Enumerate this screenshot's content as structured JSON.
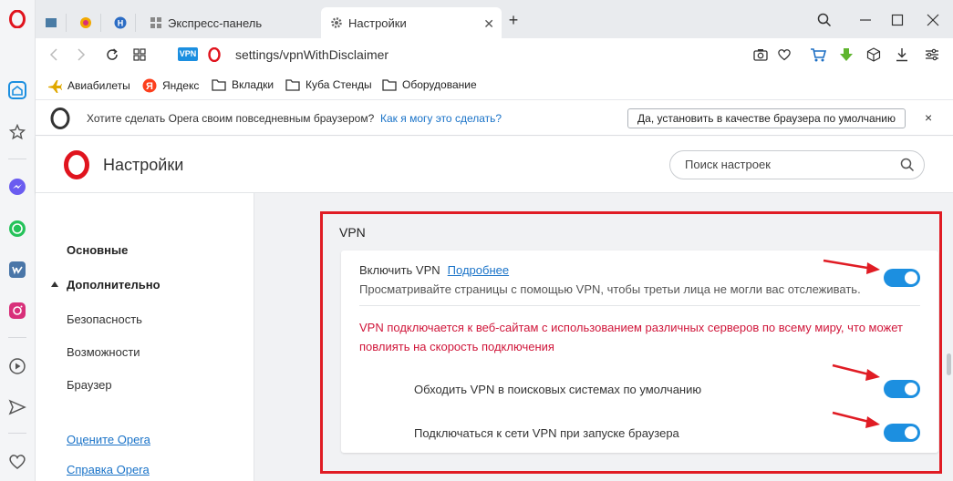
{
  "browser": {
    "tabs": [
      {
        "label": ""
      },
      {
        "label": ""
      },
      {
        "label": ""
      },
      {
        "label": "Экспресс-панель"
      },
      {
        "label": "Настройки"
      }
    ],
    "new_tab": "+",
    "url": "settings/vpnWithDisclaimer",
    "vpn_badge": "VPN"
  },
  "bookmarks": [
    {
      "label": "Авиабилеты",
      "icon": "plane-icon"
    },
    {
      "label": "Яндекс",
      "icon": "yandex-icon"
    },
    {
      "label": "Вкладки",
      "icon": "folder-icon"
    },
    {
      "label": "Куба Стенды",
      "icon": "folder-icon"
    },
    {
      "label": "Оборудование",
      "icon": "folder-icon"
    }
  ],
  "infobar": {
    "message": "Хотите сделать Opera своим повседневным браузером?",
    "link": "Как я могу это сделать?",
    "button": "Да, установить в качестве браузера по умолчанию",
    "close": "×"
  },
  "settings": {
    "title": "Настройки",
    "search_placeholder": "Поиск настроек"
  },
  "menu": {
    "basic": "Основные",
    "advanced": "Дополнительно",
    "items": [
      "Безопасность",
      "Возможности",
      "Браузер"
    ],
    "links": [
      "Оцените Opera",
      "Справка Opera"
    ]
  },
  "vpn": {
    "section_title": "VPN",
    "enable_label": "Включить VPN",
    "more_link": "Подробнее",
    "enable_desc": "Просматривайте страницы с помощью VPN, чтобы третьи лица не могли вас отслеживать.",
    "warning": "VPN подключается к веб-сайтам с использованием различных серверов по всему миру, что может повлиять на скорость подключения",
    "bypass_label": "Обходить VPN в поисковых системах по умолчанию",
    "connect_label": "Подключаться к сети VPN при запуске браузера",
    "enable_on": true,
    "bypass_on": true,
    "connect_on": true
  },
  "colors": {
    "accent": "#1c8fe0",
    "highlight": "#e01c24",
    "warning_text": "#d0163a",
    "opera_red": "#e0141e"
  }
}
